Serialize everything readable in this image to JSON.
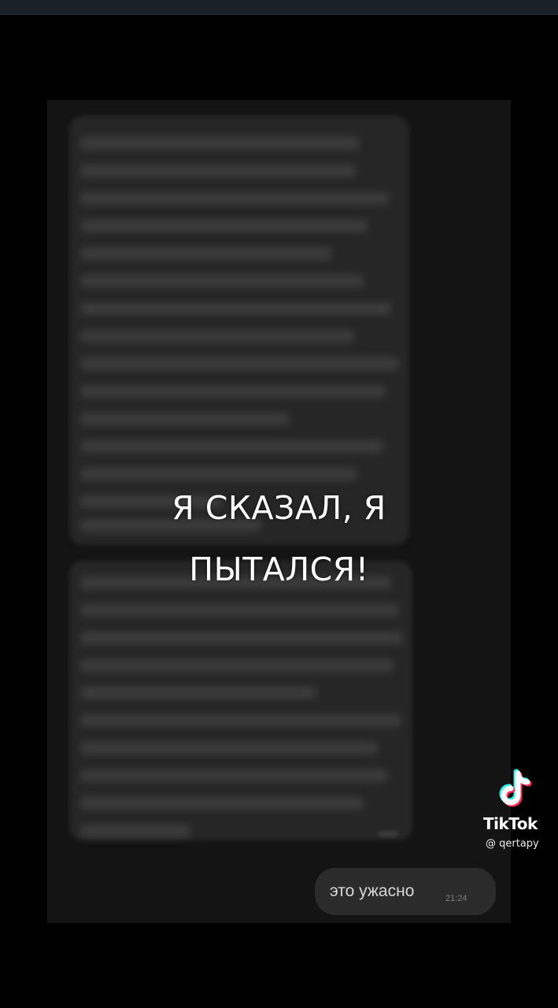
{
  "caption": {
    "line1": "Я СКАЗАЛ, Я",
    "line2": "ПЫТАЛСЯ!"
  },
  "sent_message": {
    "text": "это ужасно",
    "time": "21:24"
  },
  "watermark": {
    "brand": "TikTok",
    "username": "@ qertapy",
    "icon": "tiktok-logo-icon"
  },
  "colors": {
    "background": "#000000",
    "frame": "#141414",
    "bubble": "#2b2b2b",
    "caption_text": "#ffffff"
  }
}
